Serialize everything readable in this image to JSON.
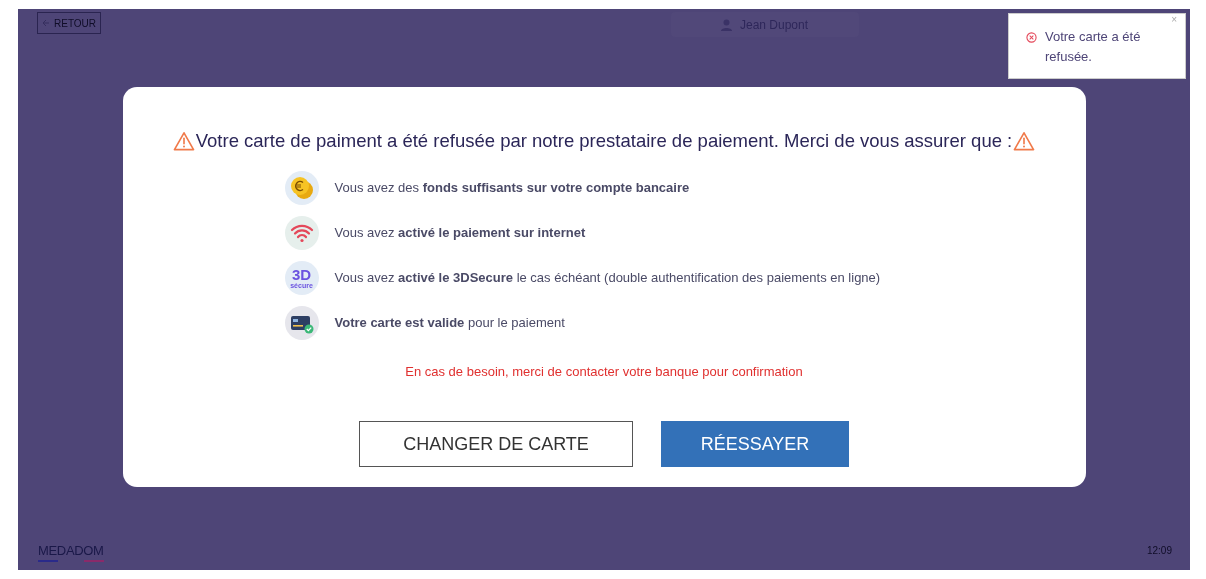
{
  "header": {
    "back_button": "RETOUR",
    "user_name": "Jean Dupont"
  },
  "toast": {
    "message": "Votre carte a été refusée.",
    "close": "×"
  },
  "dialog": {
    "title": "Votre carte de paiment a été refusée par notre prestataire de paiement. Merci de vous assurer que :",
    "checks": [
      {
        "kind": "coin",
        "text": "Vous avez des **fonds suffisants sur votre compte bancaire**"
      },
      {
        "kind": "wifi",
        "text": "Vous avez **activé le paiement sur internet**"
      },
      {
        "kind": "secure",
        "badge": "3D",
        "badge_sub": "sécure",
        "text": "Vous avez **activé le 3DSecure** le cas échéant (double authentification des paiements en ligne)"
      },
      {
        "kind": "card",
        "text": "**Votre carte est valide** pour le paiement"
      }
    ],
    "notice": "En cas de besoin, merci de contacter votre banque pour confirmation",
    "buttons": [
      {
        "kind": "outline",
        "label": "CHANGER DE CARTE"
      },
      {
        "kind": "primary",
        "label": "RÉESSAYER"
      }
    ]
  },
  "footer": {
    "logo": "MEDADOM",
    "time": "12:09"
  }
}
